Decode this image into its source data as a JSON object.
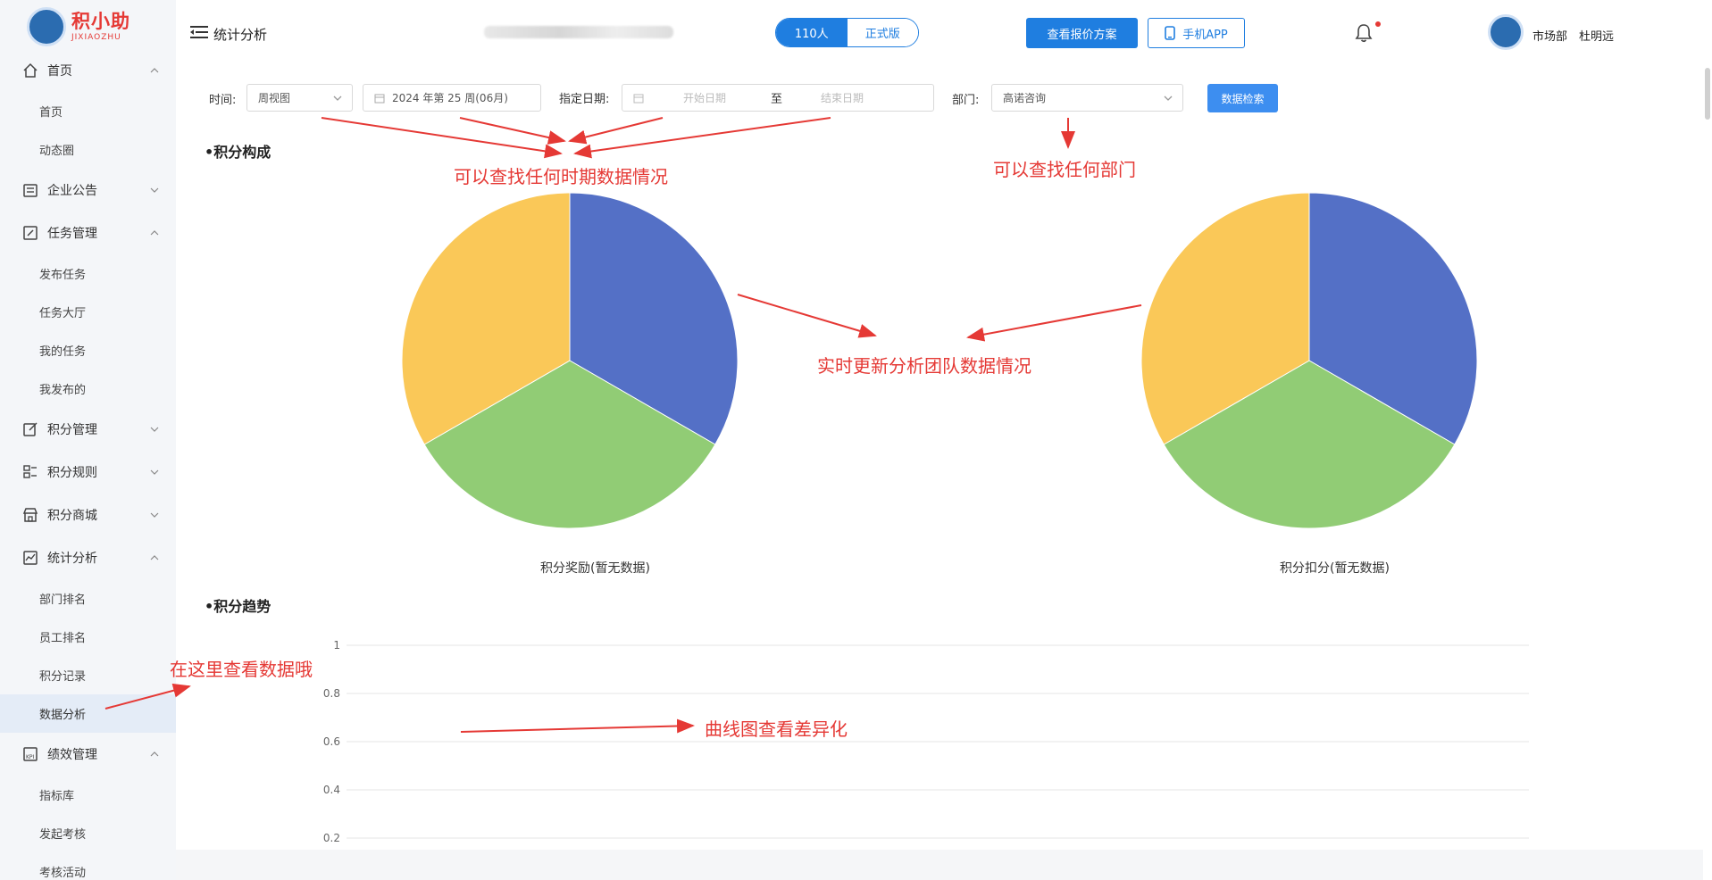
{
  "brand": {
    "name_cn": "积小助",
    "name_en": "JIXIAOZHU"
  },
  "header": {
    "page_title": "统计分析",
    "seg_people": "110人",
    "seg_version": "正式版",
    "plan_button": "查看报价方案",
    "app_button": "手机APP",
    "user_dept": "市场部",
    "user_name": "杜明远"
  },
  "sidebar": [
    {
      "label": "首页",
      "icon": "home-icon",
      "expanded": true,
      "children": [
        "首页",
        "动态圈"
      ]
    },
    {
      "label": "企业公告",
      "icon": "announcement-icon",
      "expanded": false,
      "children": []
    },
    {
      "label": "任务管理",
      "icon": "task-icon",
      "expanded": true,
      "children": [
        "发布任务",
        "任务大厅",
        "我的任务",
        "我发布的"
      ]
    },
    {
      "label": "积分管理",
      "icon": "edit-icon",
      "expanded": false,
      "children": []
    },
    {
      "label": "积分规则",
      "icon": "rules-icon",
      "expanded": false,
      "children": []
    },
    {
      "label": "积分商城",
      "icon": "store-icon",
      "expanded": false,
      "children": []
    },
    {
      "label": "统计分析",
      "icon": "chart-icon",
      "expanded": true,
      "children": [
        "部门排名",
        "员工排名",
        "积分记录",
        "数据分析"
      ]
    },
    {
      "label": "绩效管理",
      "icon": "kpi-icon",
      "expanded": true,
      "children": [
        "指标库",
        "发起考核",
        "考核活动"
      ]
    }
  ],
  "active_item": "数据分析",
  "filters": {
    "time_label": "时间:",
    "time_mode": "周视图",
    "week_value": "2024 年第 25 周(06月)",
    "date_label": "指定日期:",
    "start_placeholder": "开始日期",
    "range_sep": "至",
    "end_placeholder": "结束日期",
    "dept_label": "部门:",
    "dept_value": "高诺咨询",
    "search_button": "数据检索"
  },
  "sections": {
    "composition": "•积分构成",
    "trend": "•积分趋势"
  },
  "colors": {
    "blue": "#5470c6",
    "green": "#91cc75",
    "yellow": "#fac858",
    "primary": "#1f7ee0",
    "annotation": "#e53935"
  },
  "chart_data": [
    {
      "type": "pie",
      "title": "积分奖励(暂无数据)",
      "slices": [
        {
          "value": 1,
          "color": "#5470c6"
        },
        {
          "value": 1,
          "color": "#91cc75"
        },
        {
          "value": 1,
          "color": "#fac858"
        }
      ]
    },
    {
      "type": "pie",
      "title": "积分扣分(暂无数据)",
      "slices": [
        {
          "value": 1,
          "color": "#5470c6"
        },
        {
          "value": 1,
          "color": "#91cc75"
        },
        {
          "value": 1,
          "color": "#fac858"
        }
      ]
    },
    {
      "type": "line",
      "title": "",
      "series": [],
      "y_ticks": [
        "1",
        "0.8",
        "0.6",
        "0.4",
        "0.2"
      ],
      "ylim": [
        0,
        1
      ],
      "grid": true
    }
  ],
  "annotations": {
    "period": "可以查找任何时期数据情况",
    "dept": "可以查找任何部门",
    "realtime": "实时更新分析团队数据情况",
    "here": "在这里查看数据哦",
    "curve": "曲线图查看差异化"
  }
}
